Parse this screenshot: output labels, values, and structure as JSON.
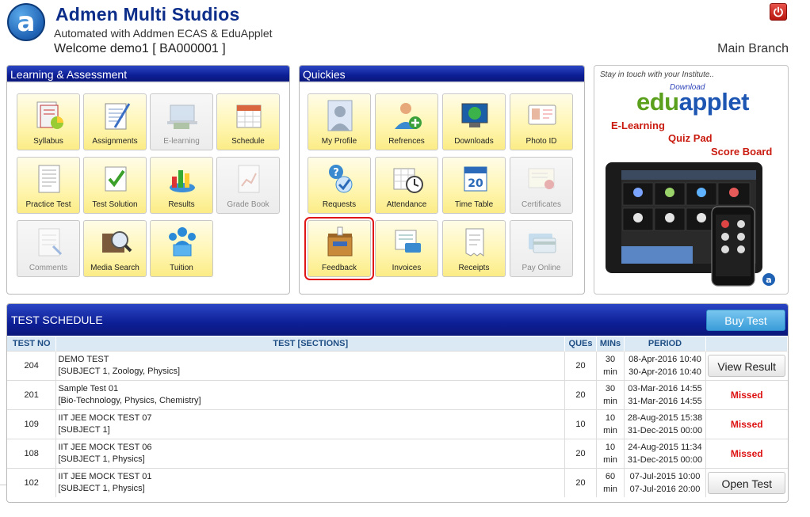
{
  "header": {
    "logo_letter": "a",
    "brand": "Admen Multi Studios",
    "subbrand": "Automated with Addmen ECAS & EduApplet",
    "welcome": "Welcome demo1 [ BA000001 ]",
    "branch": "Main Branch",
    "power_icon": "power-icon"
  },
  "learning": {
    "title": "Learning & Assessment",
    "tiles": [
      {
        "label": "Syllabus",
        "icon": "syllabus-icon",
        "enabled": true
      },
      {
        "label": "Assignments",
        "icon": "assignments-icon",
        "enabled": true
      },
      {
        "label": "E-learning",
        "icon": "elearning-icon",
        "enabled": false
      },
      {
        "label": "Schedule",
        "icon": "calendar-icon",
        "enabled": true
      },
      {
        "label": "Practice Test",
        "icon": "practice-test-icon",
        "enabled": true
      },
      {
        "label": "Test Solution",
        "icon": "checkmark-icon",
        "enabled": true
      },
      {
        "label": "Results",
        "icon": "results-chart-icon",
        "enabled": true
      },
      {
        "label": "Grade Book",
        "icon": "grade-book-icon",
        "enabled": false
      },
      {
        "label": "Comments",
        "icon": "comments-icon",
        "enabled": false
      },
      {
        "label": "Media Search",
        "icon": "media-search-icon",
        "enabled": true
      },
      {
        "label": "Tuition",
        "icon": "tuition-icon",
        "enabled": true
      }
    ]
  },
  "quickies": {
    "title": "Quickies",
    "tiles": [
      {
        "label": "My Profile",
        "icon": "profile-icon",
        "enabled": true
      },
      {
        "label": "Refrences",
        "icon": "references-icon",
        "enabled": true
      },
      {
        "label": "Downloads",
        "icon": "downloads-icon",
        "enabled": true
      },
      {
        "label": "Photo ID",
        "icon": "photo-id-icon",
        "enabled": true
      },
      {
        "label": "Requests",
        "icon": "requests-icon",
        "enabled": true
      },
      {
        "label": "Attendance",
        "icon": "attendance-icon",
        "enabled": true
      },
      {
        "label": "Time Table",
        "icon": "time-table-icon",
        "enabled": true
      },
      {
        "label": "Certificates",
        "icon": "certificate-icon",
        "enabled": false
      },
      {
        "label": "Feedback",
        "icon": "feedback-box-icon",
        "enabled": true,
        "selected": true
      },
      {
        "label": "Invoices",
        "icon": "invoices-icon",
        "enabled": true
      },
      {
        "label": "Receipts",
        "icon": "receipts-icon",
        "enabled": true
      },
      {
        "label": "Pay Online",
        "icon": "credit-card-icon",
        "enabled": false
      }
    ]
  },
  "ad": {
    "tagline": "Stay in touch with your Institute..",
    "download": "Download",
    "logo_part1": "edu",
    "logo_part2": "applet",
    "features": [
      "E-Learning",
      "Quiz Pad",
      "Score Board"
    ]
  },
  "schedule": {
    "title": "TEST SCHEDULE",
    "buy_label": "Buy Test",
    "columns": [
      "TEST NO",
      "TEST [SECTIONS]",
      "QUEs",
      "MINs",
      "PERIOD",
      ""
    ],
    "rows": [
      {
        "no": "204",
        "name": "DEMO TEST",
        "sections": "[SUBJECT 1, Zoology, Physics]",
        "ques": "20",
        "mins": "30",
        "unit": "min",
        "from": "08-Apr-2016 10:40",
        "to": "30-Apr-2016 10:40",
        "action": "View Result",
        "type": "button"
      },
      {
        "no": "201",
        "name": "Sample Test 01",
        "sections": "[Bio-Technology, Physics, Chemistry]",
        "ques": "20",
        "mins": "30",
        "unit": "min",
        "from": "03-Mar-2016 14:55",
        "to": "31-Mar-2016 14:55",
        "action": "Missed",
        "type": "status"
      },
      {
        "no": "109",
        "name": "IIT JEE MOCK TEST 07",
        "sections": "[SUBJECT 1]",
        "ques": "10",
        "mins": "10",
        "unit": "min",
        "from": "28-Aug-2015 15:38",
        "to": "31-Dec-2015 00:00",
        "action": "Missed",
        "type": "status"
      },
      {
        "no": "108",
        "name": "IIT JEE MOCK TEST 06",
        "sections": "[SUBJECT 1, Physics]",
        "ques": "20",
        "mins": "10",
        "unit": "min",
        "from": "24-Aug-2015 11:34",
        "to": "31-Dec-2015 00:00",
        "action": "Missed",
        "type": "status"
      },
      {
        "no": "102",
        "name": "IIT JEE MOCK TEST 01",
        "sections": "[SUBJECT 1, Physics]",
        "ques": "20",
        "mins": "60",
        "unit": "min",
        "from": "07-Jul-2015 10:00",
        "to": "07-Jul-2016 20:00",
        "action": "Open Test",
        "type": "button"
      }
    ]
  }
}
